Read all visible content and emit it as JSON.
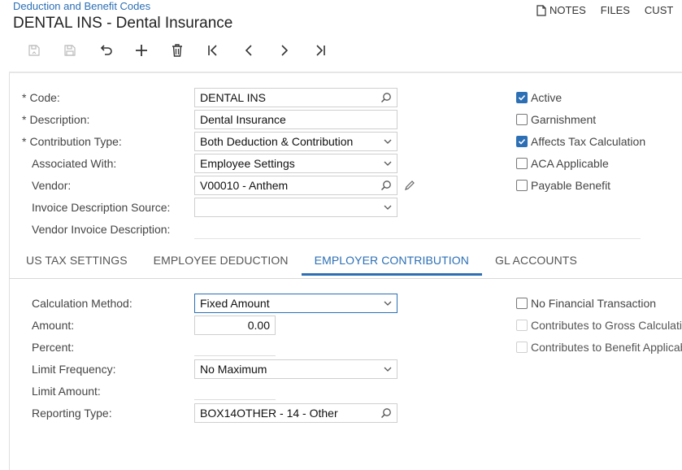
{
  "header": {
    "breadcrumb": "Deduction and Benefit Codes",
    "title": "DENTAL INS - Dental Insurance",
    "links": {
      "notes": "NOTES",
      "files": "FILES",
      "customization": "CUST"
    }
  },
  "toolbar": {
    "buttons": [
      "save-icon",
      "save-close-icon",
      "undo-icon",
      "add-icon",
      "delete-icon",
      "first-icon",
      "previous-icon",
      "next-icon",
      "last-icon"
    ]
  },
  "form": {
    "required_mark": "*",
    "code": {
      "label": "Code:",
      "value": "DENTAL INS"
    },
    "description": {
      "label": "Description:",
      "value": "Dental Insurance"
    },
    "contribution_type": {
      "label": "Contribution Type:",
      "value": "Both Deduction & Contribution"
    },
    "associated_with": {
      "label": "Associated With:",
      "value": "Employee Settings"
    },
    "vendor": {
      "label": "Vendor:",
      "value": "V00010 - Anthem"
    },
    "invoice_description_source": {
      "label": "Invoice Description Source:",
      "value": ""
    },
    "vendor_invoice_description": {
      "label": "Vendor Invoice Description:"
    }
  },
  "flags": {
    "active": {
      "label": "Active",
      "checked": true
    },
    "garnishment": {
      "label": "Garnishment",
      "checked": false
    },
    "affects_tax": {
      "label": "Affects Tax Calculation",
      "checked": true
    },
    "aca_applicable": {
      "label": "ACA Applicable",
      "checked": false
    },
    "payable_benefit": {
      "label": "Payable Benefit",
      "checked": false
    }
  },
  "tabs": [
    {
      "label": "US TAX SETTINGS",
      "active": false
    },
    {
      "label": "EMPLOYEE DEDUCTION",
      "active": false
    },
    {
      "label": "EMPLOYER CONTRIBUTION",
      "active": true
    },
    {
      "label": "GL ACCOUNTS",
      "active": false
    }
  ],
  "employer": {
    "calculation_method": {
      "label": "Calculation Method:",
      "value": "Fixed Amount"
    },
    "amount": {
      "label": "Amount:",
      "value": "0.00"
    },
    "percent": {
      "label": "Percent:"
    },
    "limit_frequency": {
      "label": "Limit Frequency:",
      "value": "No Maximum"
    },
    "limit_amount": {
      "label": "Limit Amount:"
    },
    "reporting_type": {
      "label": "Reporting Type:",
      "value": "BOX14OTHER - 14 - Other"
    },
    "no_financial": {
      "label": "No Financial Transaction",
      "checked": false
    },
    "gross_calc": {
      "label": "Contributes to Gross Calculation",
      "checked": false,
      "disabled": true
    },
    "benefit_applicable": {
      "label": "Contributes to Benefit Applicable",
      "checked": false,
      "disabled": true
    }
  },
  "colors": {
    "accent": "#2c6fb5"
  }
}
